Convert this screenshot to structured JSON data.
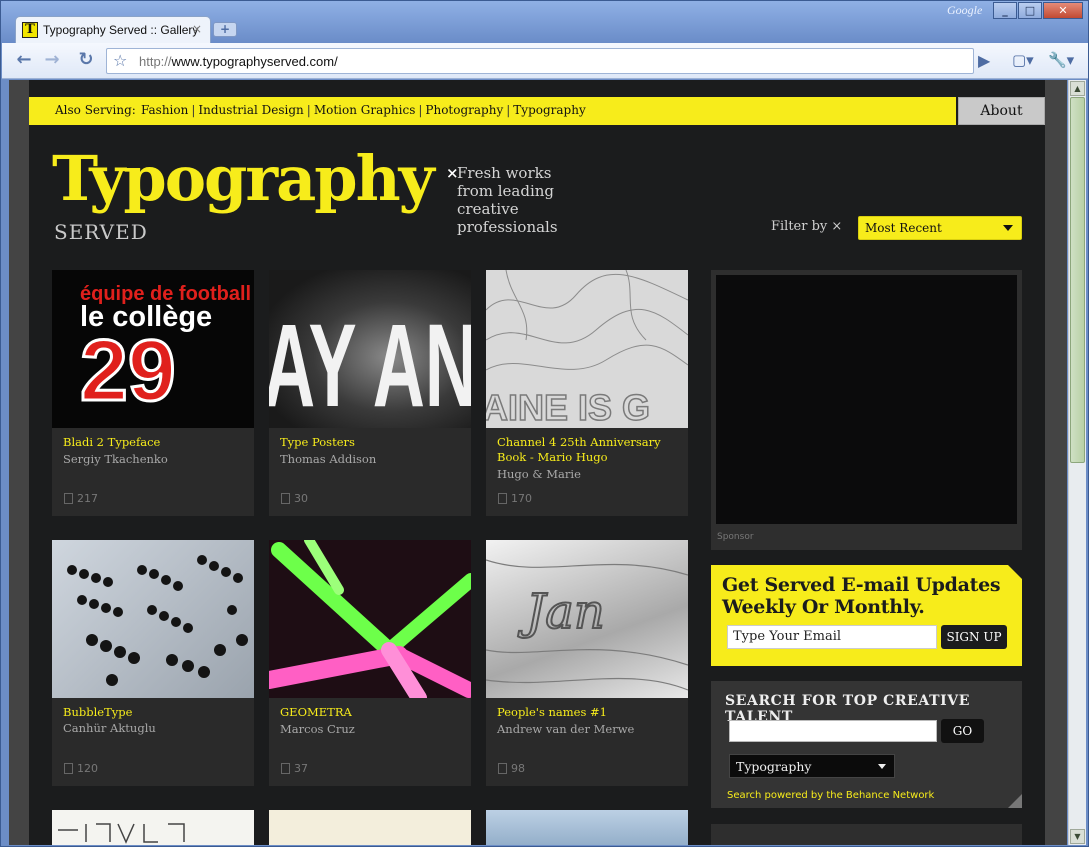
{
  "browser": {
    "tab_title": "Typography Served :: Gallery",
    "tab_close": "×",
    "new_tab": "+",
    "brand": "Google",
    "url_prefix": "http://",
    "url_rest": "www.typographyserved.com/",
    "back": "←",
    "forward": "→",
    "reload": "↻",
    "bookmark_star": "☆",
    "go": "▶",
    "page_menu": "▢▾",
    "tools_menu": "🔧▾",
    "win_min": "_",
    "win_max": "□",
    "win_close": "✕",
    "favicon": "T"
  },
  "site": {
    "also_serving_label": "Also Serving:",
    "nav": [
      "Fashion",
      "Industrial Design",
      "Motion Graphics",
      "Photography",
      "Typography"
    ],
    "about": "About",
    "logo": "Typography",
    "served": "SERVED",
    "tagline_mark": "×",
    "tagline": [
      "Fresh works",
      "from leading",
      "creative",
      "professionals"
    ],
    "filter_label": "Filter by ×",
    "filter_value": "Most Recent",
    "accent_color": "#f7ec1b"
  },
  "gallery": [
    {
      "title": "Bladi 2 Typeface",
      "author": "Sergiy Tkachenko",
      "count": "217"
    },
    {
      "title": "Type Posters",
      "author": "Thomas Addison",
      "count": "30"
    },
    {
      "title": "Channel 4 25th Anniversary Book - Mario Hugo",
      "author": "Hugo & Marie",
      "count": "170"
    },
    {
      "title": "BubbleType",
      "author": "Canhür Aktuglu",
      "count": "120"
    },
    {
      "title": "GEOMETRA",
      "author": "Marcos Cruz",
      "count": "37"
    },
    {
      "title": "People's names #1",
      "author": "Andrew van der Merwe",
      "count": "98"
    }
  ],
  "thumb_text": {
    "equipe": "équipe de football",
    "college": "le collège",
    "num29": "29",
    "ayan": "AY AN",
    "gen": "AINE IS G",
    "jan": "Jan"
  },
  "sidebar": {
    "sponsor": "Sponsor",
    "email_heading": "Get Served E-mail Updates Weekly Or Monthly.",
    "email_placeholder": "Type Your Email",
    "signup": "SIGN UP",
    "search_heading": "SEARCH FOR TOP CREATIVE TALENT",
    "search_go": "GO",
    "search_select": "Typography",
    "powered": "Search powered by the Behance Network"
  }
}
